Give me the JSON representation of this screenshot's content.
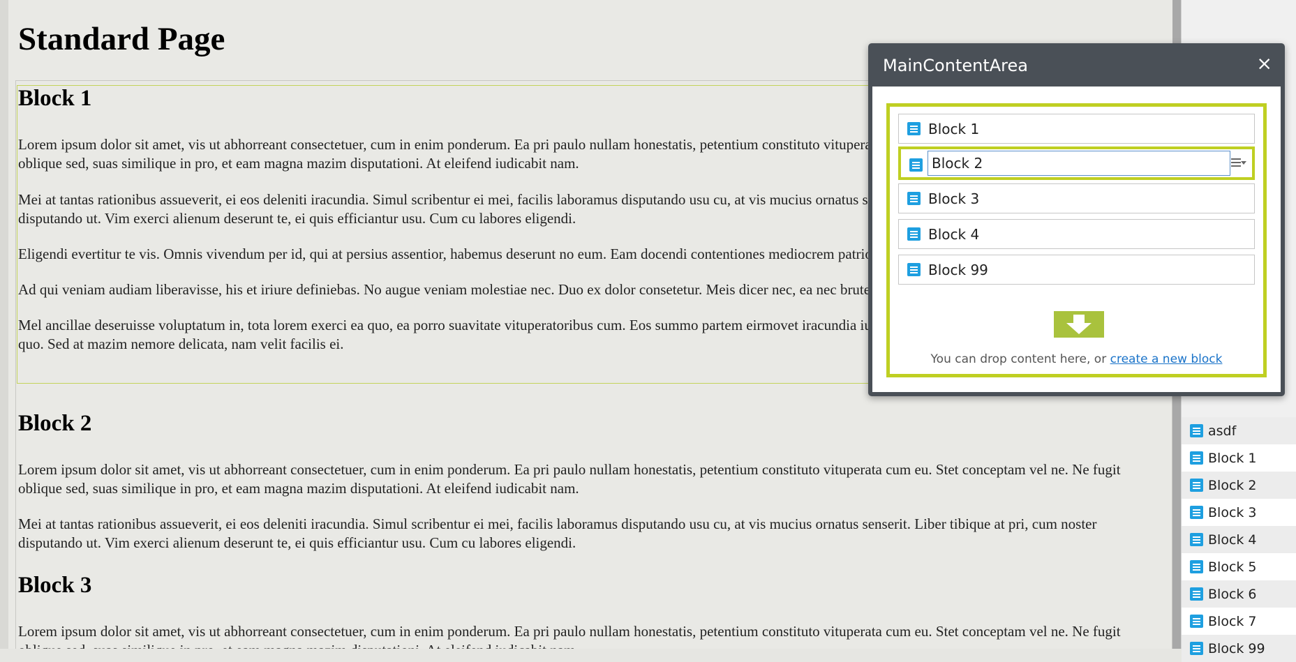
{
  "page": {
    "title": "Standard Page",
    "blocks": [
      {
        "heading": "Block 1",
        "paragraphs": [
          "Lorem ipsum dolor sit amet, vis ut abhorreant consectetuer, cum in enim ponderum. Ea pri paulo nullam honestatis, petentium constituto vituperata cum eu. Stet conceptam vel ne. Ne fugit oblique sed, suas similique in pro, et eam magna mazim disputationi. At eleifend iudicabit nam.",
          "Mei at tantas rationibus assueverit, ei eos deleniti iracundia. Simul scribentur ei mei, facilis laboramus disputando usu cu, at vis mucius ornatus senserit. Liber tibique at pri, cum noster disputando ut. Vim exerci alienum deserunt te, ei quis efficiantur usu. Cum cu labores eligendi.",
          "Eligendi evertitur te vis. Omnis vivendum per id, qui at persius assentior, habemus deserunt no eum. Eam docendi contentiones mediocrem patrioque ne eam, pri ad duis aliquam.",
          "Ad qui veniam audiam liberavisse, his et iriure definiebas. No augue veniam molestiae nec. Duo ex dolor consetetur. Meis dicer nec, ea nec brute graeco eligendi.",
          "Mel ancillae deseruisse voluptatum in, tota lorem exerci ea quo, ea porro suavitate vituperatoribus cum. Eos summo partem eirmovet iracundia ius no, mel et utamur explicari. Scripta fuisset te quo. Sed at mazim nemore delicata, nam velit facilis ei."
        ]
      },
      {
        "heading": "Block 2",
        "paragraphs": [
          "Lorem ipsum dolor sit amet, vis ut abhorreant consectetuer, cum in enim ponderum. Ea pri paulo nullam honestatis, petentium constituto vituperata cum eu. Stet conceptam vel ne. Ne fugit oblique sed, suas similique in pro, et eam magna mazim disputationi. At eleifend iudicabit nam.",
          "Mei at tantas rationibus assueverit, ei eos deleniti iracundia. Simul scribentur ei mei, facilis laboramus disputando usu cu, at vis mucius ornatus senserit. Liber tibique at pri, cum noster disputando ut. Vim exerci alienum deserunt te, ei quis efficiantur usu. Cum cu labores eligendi."
        ]
      },
      {
        "heading": "Block 3",
        "paragraphs": [
          "Lorem ipsum dolor sit amet, vis ut abhorreant consectetuer, cum in enim ponderum. Ea pri paulo nullam honestatis, petentium constituto vituperata cum eu. Stet conceptam vel ne. Ne fugit oblique sed, suas similique in pro, et eam magna mazim disputationi. At eleifend iudicabit nam."
        ]
      }
    ]
  },
  "dialog": {
    "title": "MainContentArea",
    "close_label": "×",
    "slots": [
      "Block 1",
      "Block 2",
      "Block 3",
      "Block 4",
      "Block 99"
    ],
    "selected_slot_value": "Block 2",
    "drop_text": "You can drop content here, or ",
    "drop_link": "create a new block"
  },
  "assets": {
    "items": [
      "asdf",
      "Block 1",
      "Block 2",
      "Block 3",
      "Block 4",
      "Block 5",
      "Block 6",
      "Block 7",
      "Block 99"
    ]
  },
  "colors": {
    "accent_green": "#bfcf22",
    "block_icon": "#1e9fe0",
    "dialog_header": "#4a5057",
    "link": "#1a73c9"
  }
}
